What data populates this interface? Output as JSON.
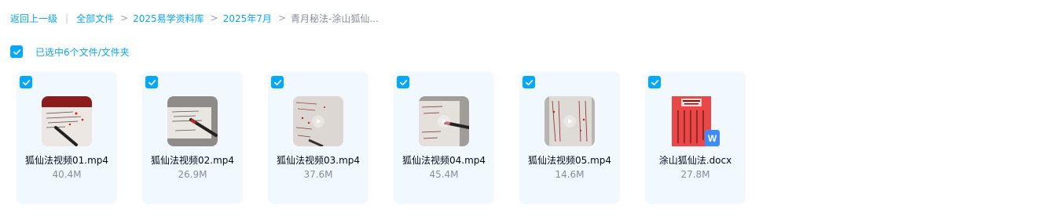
{
  "breadcrumb": {
    "back": "返回上一级",
    "separator": "|",
    "items": [
      "全部文件",
      "2025易学资料库",
      "2025年7月"
    ],
    "current": "青月秘法-涂山狐仙..."
  },
  "selection": {
    "label": "已选中6个文件/文件夹",
    "checked": true
  },
  "files": [
    {
      "name": "狐仙法视频01.mp4",
      "size": "40.4M",
      "type": "video",
      "selected": true
    },
    {
      "name": "狐仙法视频02.mp4",
      "size": "26.9M",
      "type": "video",
      "selected": true
    },
    {
      "name": "狐仙法视频03.mp4",
      "size": "37.6M",
      "type": "video",
      "selected": true
    },
    {
      "name": "狐仙法视频04.mp4",
      "size": "45.4M",
      "type": "video",
      "selected": true
    },
    {
      "name": "狐仙法视频05.mp4",
      "size": "14.6M",
      "type": "video",
      "selected": true
    },
    {
      "name": "涂山狐仙法.docx",
      "size": "27.8M",
      "type": "docx",
      "selected": true
    }
  ],
  "icons": {
    "checkbox": "checkmark-icon",
    "play": "play-icon",
    "word": "word-doc-icon"
  },
  "word_badge": "W",
  "colors": {
    "accent": "#06a7ff",
    "card_bg": "#f1f8fe",
    "word_blue": "#3e8aff"
  }
}
